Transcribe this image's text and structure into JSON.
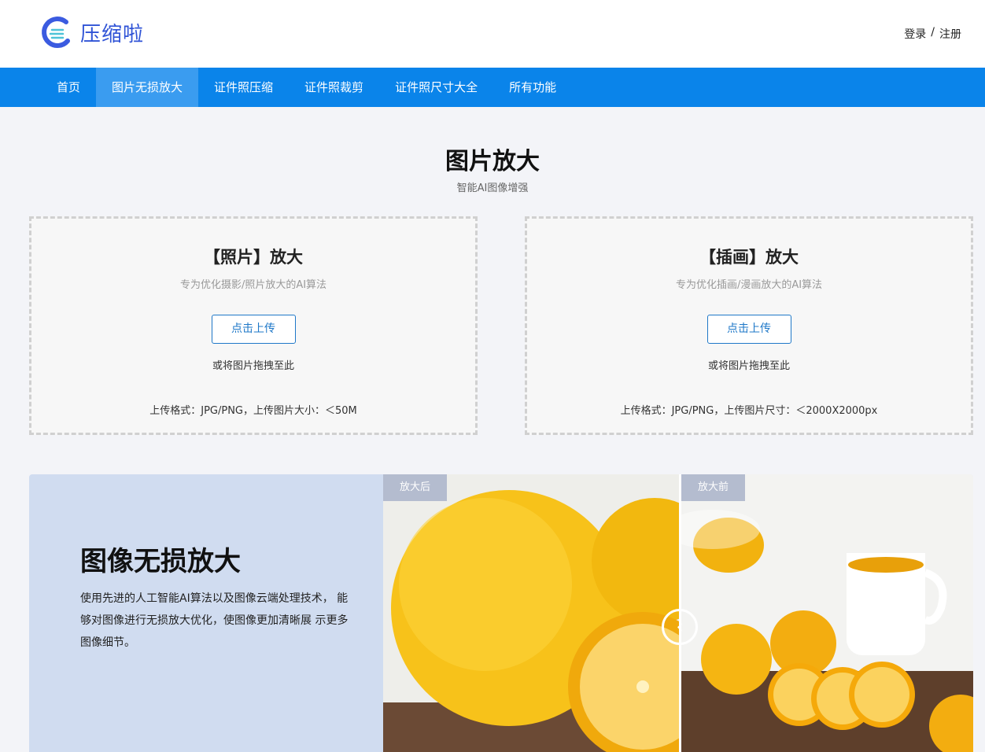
{
  "brand": {
    "name": "压缩啦",
    "accent": "#2f53d6"
  },
  "auth": {
    "login": "登录",
    "separator": "/",
    "register": "注册"
  },
  "nav": {
    "items": [
      {
        "label": "首页"
      },
      {
        "label": "图片无损放大"
      },
      {
        "label": "证件照压缩"
      },
      {
        "label": "证件照裁剪"
      },
      {
        "label": "证件照尺寸大全"
      },
      {
        "label": "所有功能"
      }
    ],
    "active_index": 1,
    "color": "#0a84ea"
  },
  "hero": {
    "title": "图片放大",
    "subtitle": "智能AI图像增强"
  },
  "upload": {
    "photo": {
      "title": "【照片】放大",
      "desc": "专为优化摄影/照片放大的AI算法",
      "button": "点击上传",
      "drag": "或将图片拖拽至此",
      "format": "上传格式：JPG/PNG，上传图片大小：＜50M"
    },
    "illustration": {
      "title": "【插画】放大",
      "desc": "专为优化插画/漫画放大的AI算法",
      "button": "点击上传",
      "drag": "或将图片拖拽至此",
      "format": "上传格式：JPG/PNG，上传图片尺寸：＜2000X2000px"
    }
  },
  "feature": {
    "title": "图像无损放大",
    "desc": "使用先进的人工智能AI算法以及图像云端处理技术， 能够对图像进行无损放大优化，使图像更加清晰展 示更多图像细节。",
    "after_label": "放大后",
    "before_label": "放大前",
    "handle_icon": "chevron-left-icon"
  }
}
